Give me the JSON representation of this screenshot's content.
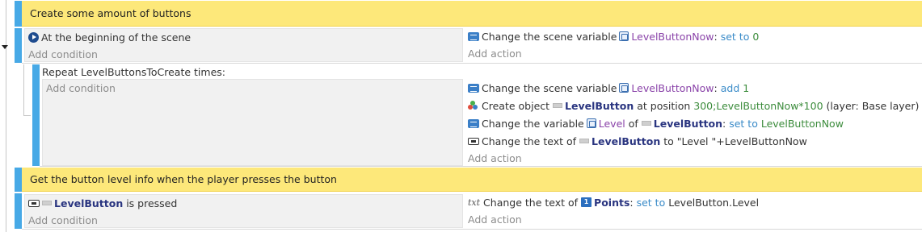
{
  "comments": [
    "Create some amount of buttons",
    "Get the button level info when the player presses the button"
  ],
  "event1": {
    "conditions": [
      {
        "icon": "scene-start-icon",
        "text": "At the beginning of the scene"
      }
    ],
    "add_condition": "Add condition",
    "actions": [
      {
        "icon": "variable-icon",
        "text": "Change the scene variable",
        "var": "LevelButtonNow",
        "sep": ":",
        "op": "set to",
        "value": "0"
      }
    ],
    "add_action": "Add action"
  },
  "repeat_event": {
    "header": "Repeat LevelButtonsToCreate times:",
    "add_condition": "Add condition",
    "actions": {
      "a1": {
        "text": "Change the scene variable",
        "var": "LevelButtonNow",
        "sep": ":",
        "op": "add",
        "value": "1"
      },
      "a2": {
        "text1": "Create object",
        "object": "LevelButton",
        "text2": "at position",
        "pos_x": "300",
        "pos_y": ";LevelButtonNow*100",
        "layer": "(layer: Base layer)"
      },
      "a3": {
        "text1": "Change the variable",
        "var": "Level",
        "text2": "of",
        "object": "LevelButton",
        "sep": ":",
        "op": "set to",
        "value": "LevelButtonNow"
      },
      "a4": {
        "text1": "Change the text of",
        "object": "LevelButton",
        "text2": "to",
        "value": "\"Level \"+LevelButtonNow"
      }
    },
    "add_action": "Add action"
  },
  "event2": {
    "condition": {
      "object": "LevelButton",
      "text": "is pressed"
    },
    "add_condition": "Add condition",
    "action": {
      "icon_label": "txt",
      "text1": "Change the text of",
      "object": "Points",
      "sep": ":",
      "op": "set to",
      "value": "LevelButton.Level"
    },
    "add_action": "Add action"
  },
  "colors": {
    "comment_bg": "#fde87a",
    "event_bar": "#47a9e6",
    "keyword": "#3a8bc8",
    "variable": "#8a43a9",
    "number": "#3c8c3c",
    "object": "#2a3580"
  }
}
